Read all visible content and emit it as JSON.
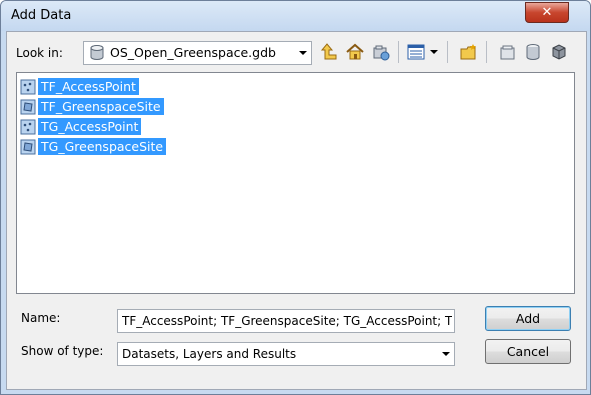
{
  "window": {
    "title": "Add Data"
  },
  "lookin": {
    "label": "Look in:",
    "value": "OS_Open_Greenspace.gdb"
  },
  "toolbar": {
    "icons": [
      "up-one-level-icon",
      "home-icon",
      "connect-folder-icon",
      "view-menu-icon",
      "new-folder-icon",
      "options-icon",
      "new-geodatabase-icon",
      "connect-database-icon"
    ]
  },
  "files": [
    {
      "label": "TF_AccessPoint",
      "icon": "point-feature-class-icon",
      "selected": true
    },
    {
      "label": "TF_GreenspaceSite",
      "icon": "polygon-feature-class-icon",
      "selected": true
    },
    {
      "label": "TG_AccessPoint",
      "icon": "point-feature-class-icon",
      "selected": true
    },
    {
      "label": "TG_GreenspaceSite",
      "icon": "polygon-feature-class-icon",
      "selected": true
    }
  ],
  "name": {
    "label": "Name:",
    "value": "TF_AccessPoint; TF_GreenspaceSite; TG_AccessPoint; TG_"
  },
  "type": {
    "label": "Show of type:",
    "value": "Datasets, Layers and Results"
  },
  "buttons": {
    "add": "Add",
    "cancel": "Cancel"
  },
  "colors": {
    "selection": "#3399ff",
    "close_button": "#c8462e",
    "title_bar": "#c7daf0"
  }
}
